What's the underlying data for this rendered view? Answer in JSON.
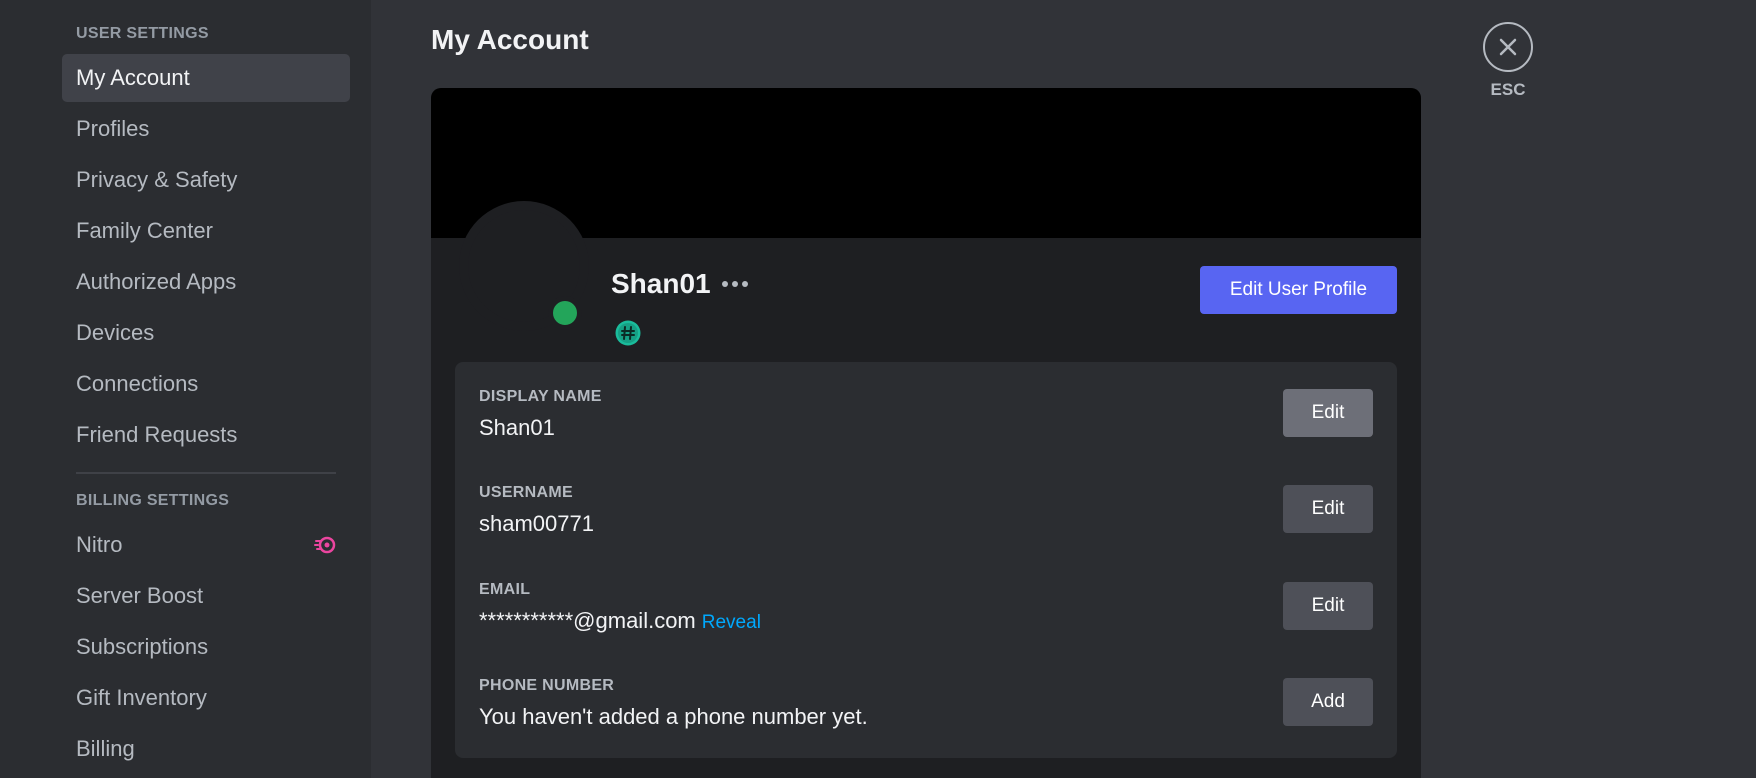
{
  "sidebar": {
    "user_settings_header": "USER SETTINGS",
    "user_items": [
      {
        "label": "My Account",
        "active": true
      },
      {
        "label": "Profiles"
      },
      {
        "label": "Privacy & Safety"
      },
      {
        "label": "Family Center"
      },
      {
        "label": "Authorized Apps"
      },
      {
        "label": "Devices"
      },
      {
        "label": "Connections"
      },
      {
        "label": "Friend Requests"
      }
    ],
    "billing_settings_header": "BILLING SETTINGS",
    "billing_items": [
      {
        "label": "Nitro",
        "icon": "nitro-icon"
      },
      {
        "label": "Server Boost"
      },
      {
        "label": "Subscriptions"
      },
      {
        "label": "Gift Inventory"
      },
      {
        "label": "Billing"
      }
    ]
  },
  "main": {
    "title": "My Account",
    "profile": {
      "display_name": "Shan01",
      "status": "online",
      "edit_profile_label": "Edit User Profile"
    },
    "fields": [
      {
        "label": "DISPLAY NAME",
        "value": "Shan01",
        "button": "Edit"
      },
      {
        "label": "USERNAME",
        "value": "sham00771",
        "button": "Edit"
      },
      {
        "label": "EMAIL",
        "value": "***********@gmail.com",
        "link": "Reveal",
        "button": "Edit"
      },
      {
        "label": "PHONE NUMBER",
        "value": "You haven't added a phone number yet.",
        "button": "Add"
      }
    ]
  },
  "close": {
    "label": "ESC"
  },
  "colors": {
    "accent": "#5865f2",
    "online": "#23a55a",
    "link": "#00a8fc",
    "nitro": "#eb459f",
    "badge": "#1abc9c"
  }
}
